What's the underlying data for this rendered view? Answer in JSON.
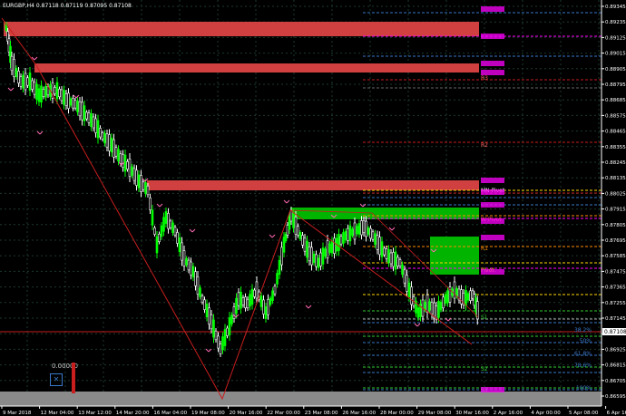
{
  "window": {
    "symbol_label": "EURGBP,H4",
    "quote_values": "0.87118 0.87119 0.87095 0.87108"
  },
  "price_axis": {
    "labels": [
      "0.89345",
      "0.89235",
      "0.89125",
      "0.89015",
      "0.88905",
      "0.88795",
      "0.88685",
      "0.88575",
      "0.88465",
      "0.88355",
      "0.88245",
      "0.88135",
      "0.88025",
      "0.87915",
      "0.87805",
      "0.87695",
      "0.87585",
      "0.87475",
      "0.87365",
      "0.87255",
      "0.87145",
      "0.87035",
      "0.86925",
      "0.86815",
      "0.86705",
      "0.86595"
    ],
    "current_price": "0.87108"
  },
  "time_axis": {
    "labels": [
      "9 Mar 2018",
      "12 Mar 04:00",
      "13 Mar 12:00",
      "14 Mar 20:00",
      "16 Mar 04:00",
      "19 Mar 08:00",
      "20 Mar 16:00",
      "22 Mar 00:00",
      "23 Mar 08:00",
      "26 Mar 16:00",
      "28 Mar 00:00",
      "29 Mar 08:00",
      "30 Mar 16:00",
      "2 Apr 16:00",
      "4 Apr 00:00",
      "5 Apr 08:00",
      "6 Apr 16:00"
    ]
  },
  "pivot_labels": [
    "R3",
    "R2",
    "MN Pivot",
    "R1",
    "W Pivot",
    "Pivot",
    "S1",
    "S2",
    "S3",
    "61.8%",
    "50%",
    "38.2%",
    "78.6%",
    "100%"
  ],
  "widget": {
    "value": "0.00000"
  },
  "colors": {
    "background": "#000000",
    "grid": "#1c3a2c",
    "bull_candle": "#00ff00",
    "bear_candle": "#ffffff",
    "resistance_zone": "#d04040",
    "support_zone": "#00b400",
    "zigzag": "#c81e1e",
    "pivot_label": "#ff00ff"
  }
}
